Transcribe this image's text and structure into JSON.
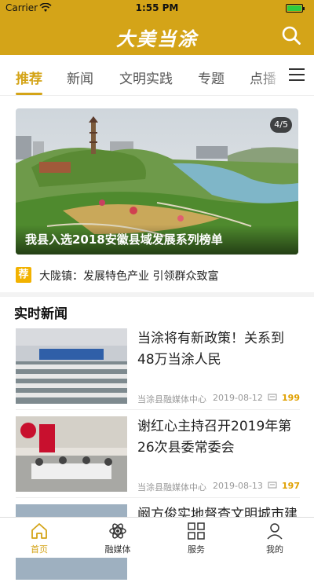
{
  "status_bar": {
    "carrier": "Carrier",
    "time": "1:55 PM"
  },
  "header": {
    "title": "大美当涂"
  },
  "tabs": [
    {
      "label": "推荐",
      "active": true
    },
    {
      "label": "新闻"
    },
    {
      "label": "文明实践"
    },
    {
      "label": "专题"
    },
    {
      "label": "点播"
    }
  ],
  "banner": {
    "caption": "我县入选2018安徽县域发展系列榜单",
    "counter": "4/5"
  },
  "recommend": {
    "badge": "荐",
    "text": "大陇镇：发展特色产业 引领群众致富"
  },
  "section": {
    "title": "实时新闻"
  },
  "news": [
    {
      "title": "当涂将有新政策！关系到48万当涂人民",
      "source": "当涂县融媒体中心",
      "date": "2019-08-12",
      "count": "199"
    },
    {
      "title": "谢红心主持召开2019年第26次县委常委会",
      "source": "当涂县融媒体中心",
      "date": "2019-08-13",
      "count": "197"
    },
    {
      "title": "阚方俊实地督查文明城市建"
    }
  ],
  "tabbar": [
    {
      "label": "首页",
      "icon": "home-icon",
      "active": true
    },
    {
      "label": "融媒体",
      "icon": "atom-icon"
    },
    {
      "label": "服务",
      "icon": "grid-icon"
    },
    {
      "label": "我的",
      "icon": "person-icon"
    }
  ],
  "colors": {
    "brand": "#d4a418",
    "count": "#e0a000"
  }
}
